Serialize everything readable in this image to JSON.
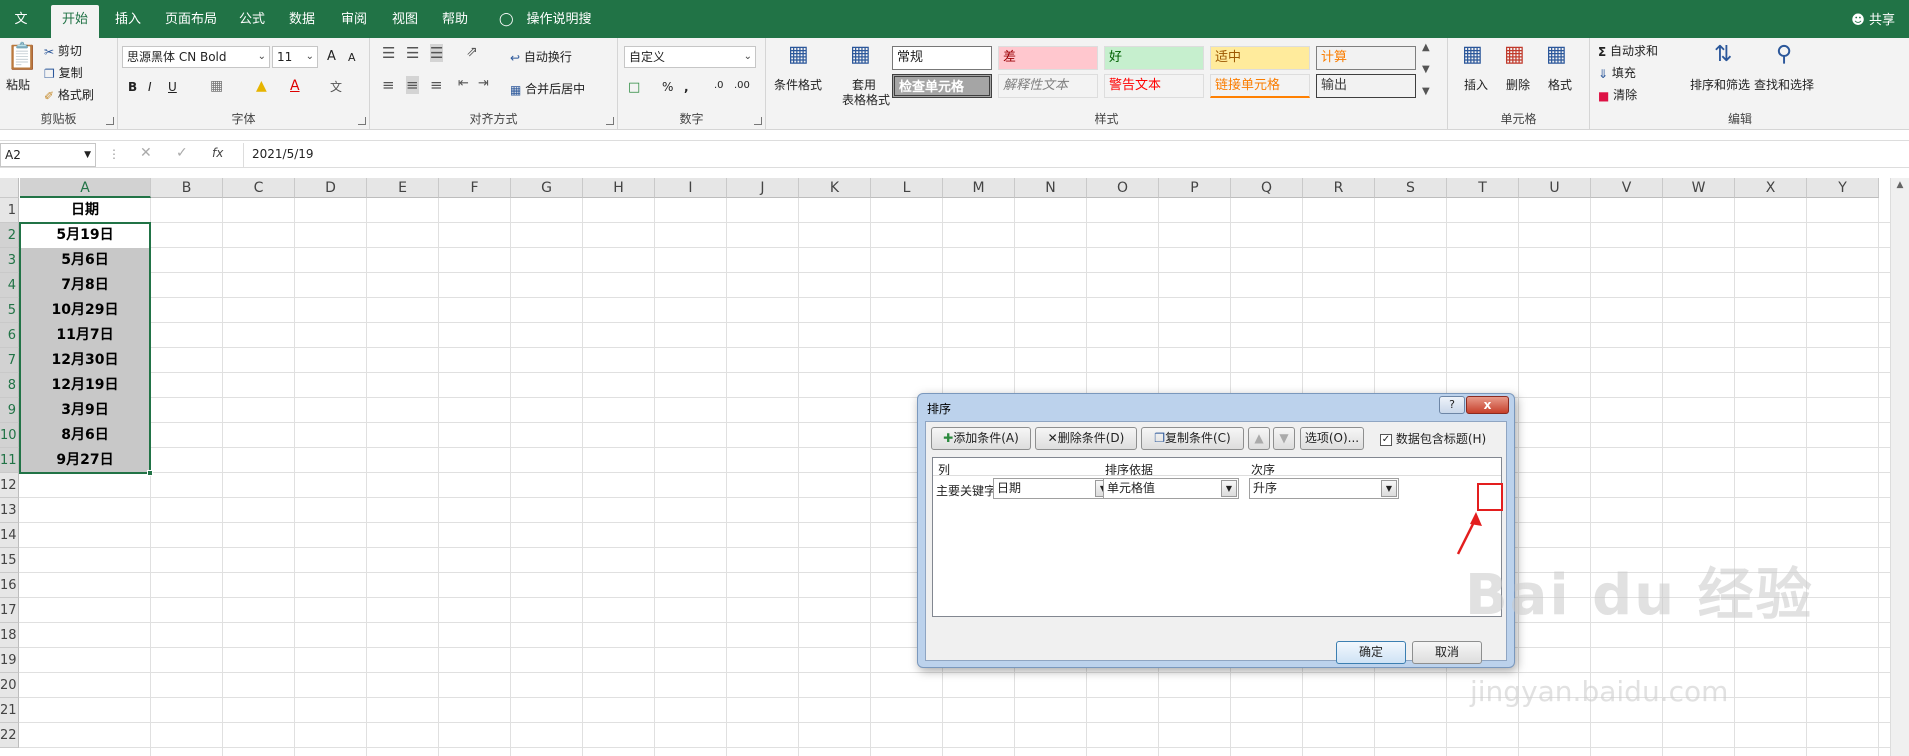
{
  "tabs": [
    "文件",
    "开始",
    "插入",
    "页面布局",
    "公式",
    "数据",
    "审阅",
    "视图",
    "帮助",
    "操作说明搜索"
  ],
  "share": "共享",
  "clipboard": {
    "paste": "粘贴",
    "cut": "剪切",
    "copy": "复制",
    "painter": "格式刷",
    "label": "剪贴板"
  },
  "font": {
    "name": "思源黑体 CN Bold",
    "size": "11",
    "bold": "B",
    "italic": "I",
    "underline": "U",
    "label": "字体",
    "grow": "A",
    "shrink": "A"
  },
  "align": {
    "wrap": "自动换行",
    "merge": "合并后居中",
    "label": "对齐方式"
  },
  "number": {
    "format": "自定义",
    "percent": "%",
    "comma": ",",
    "label": "数字"
  },
  "styles": {
    "cond": "条件格式",
    "table1": "套用",
    "table2": "表格格式",
    "items": [
      "常规",
      "差",
      "好",
      "适中",
      "计算",
      "检查单元格",
      "解释性文本",
      "警告文本",
      "链接单元格",
      "输出"
    ],
    "label": "样式"
  },
  "cells": {
    "insert": "插入",
    "delete": "删除",
    "format": "格式",
    "label": "单元格"
  },
  "editing": {
    "autosum": "自动求和",
    "fill": "填充",
    "clear": "清除",
    "sort": "排序和筛选",
    "find": "查找和选择",
    "label": "编辑"
  },
  "namebox": "A2",
  "fx": "fx",
  "formula": "2021/5/19",
  "columns": [
    "A",
    "B",
    "C",
    "D",
    "E",
    "F",
    "G",
    "H",
    "I",
    "J",
    "K",
    "L",
    "M",
    "N",
    "O",
    "P",
    "Q",
    "R",
    "S",
    "T",
    "U",
    "V",
    "W",
    "X",
    "Y"
  ],
  "rows": [
    "1",
    "2",
    "3",
    "4",
    "5",
    "6",
    "7",
    "8",
    "9",
    "10",
    "11",
    "12",
    "13",
    "14",
    "15",
    "16",
    "17",
    "18",
    "19",
    "20",
    "21",
    "22"
  ],
  "cellsA": [
    "日期",
    "5月19日",
    "5月6日",
    "7月8日",
    "10月29日",
    "11月7日",
    "12月30日",
    "12月19日",
    "3月9日",
    "8月6日",
    "9月27日"
  ],
  "dialog": {
    "title": "排序",
    "help": "?",
    "close": "x",
    "add": "添加条件(A)",
    "delete": "删除条件(D)",
    "copy": "复制条件(C)",
    "options": "选项(O)...",
    "has_header": "数据包含标题(H)",
    "col_header": "列",
    "by_header": "排序依据",
    "order_header": "次序",
    "primary": "主要关键字",
    "col_value": "日期",
    "by_value": "单元格值",
    "order_value": "升序",
    "ok": "确定",
    "cancel": "取消"
  },
  "watermark": "Bai du 经验",
  "watermark_url": "jingyan.baidu.com"
}
